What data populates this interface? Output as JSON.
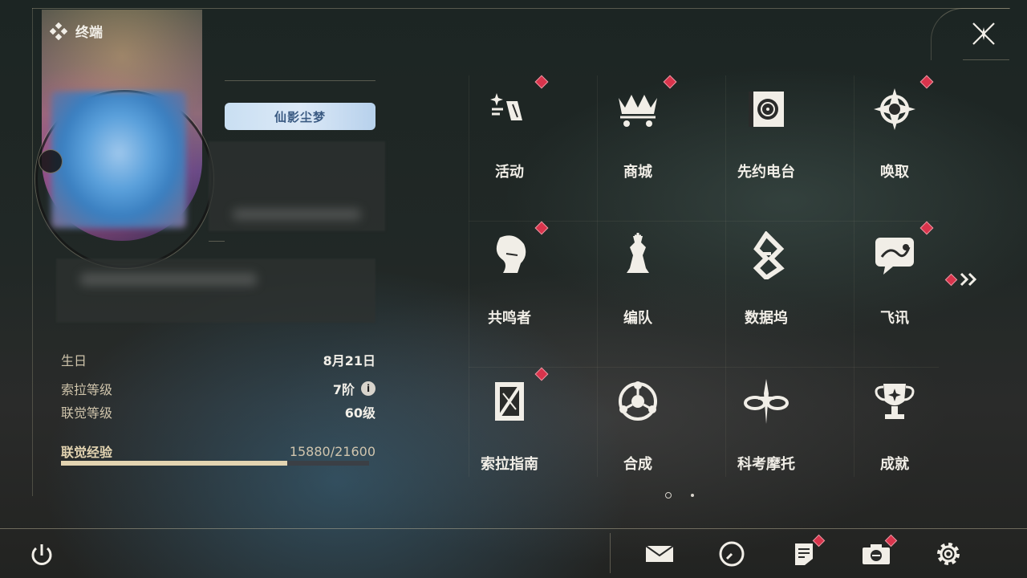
{
  "window": {
    "title": "终端",
    "close_icon": "close-x-icon"
  },
  "profile": {
    "badge_label": "仙影尘梦",
    "info": [
      {
        "label": "生日",
        "value": "8月21日"
      },
      {
        "label": "索拉等级",
        "value": "7阶",
        "has_info_icon": true
      },
      {
        "label": "联觉等级",
        "value": "60级"
      }
    ],
    "experience": {
      "label": "联觉经验",
      "value_text": "15880/21600",
      "current": 15880,
      "max": 21600
    }
  },
  "menu": {
    "items": [
      {
        "label": "活动",
        "icon": "activity-icon",
        "has_alert": true
      },
      {
        "label": "商城",
        "icon": "shop-crown-cart-icon",
        "has_alert": true
      },
      {
        "label": "先约电台",
        "icon": "radio-icon",
        "has_alert": false
      },
      {
        "label": "唤取",
        "icon": "summon-compass-icon",
        "has_alert": true
      },
      {
        "label": "共鸣者",
        "icon": "resonator-portrait-icon",
        "has_alert": true
      },
      {
        "label": "编队",
        "icon": "team-chess-icon",
        "has_alert": false
      },
      {
        "label": "数据坞",
        "icon": "data-dock-icon",
        "has_alert": false
      },
      {
        "label": "飞讯",
        "icon": "chat-message-icon",
        "has_alert": true
      },
      {
        "label": "索拉指南",
        "icon": "guide-book-icon",
        "has_alert": true
      },
      {
        "label": "合成",
        "icon": "synthesis-icon",
        "has_alert": false
      },
      {
        "label": "科考摩托",
        "icon": "motorcycle-icon",
        "has_alert": false
      },
      {
        "label": "成就",
        "icon": "trophy-icon",
        "has_alert": false
      }
    ],
    "next_page_icon": "double-chevron-right-icon",
    "pages": 2,
    "current_page": 1
  },
  "bottom_bar": {
    "power_icon": "power-icon",
    "buttons": [
      {
        "icon": "mail-icon",
        "has_alert": false
      },
      {
        "icon": "clock-icon",
        "has_alert": false
      },
      {
        "icon": "notice-icon",
        "has_alert": true
      },
      {
        "icon": "camera-icon",
        "has_alert": true
      },
      {
        "icon": "settings-gear-icon",
        "has_alert": false
      }
    ]
  },
  "colors": {
    "accent_gold": "#e3d4b1",
    "alert_red": "#d9344c",
    "text_light": "#f1eee7",
    "label_tan": "#cfc4ab"
  }
}
